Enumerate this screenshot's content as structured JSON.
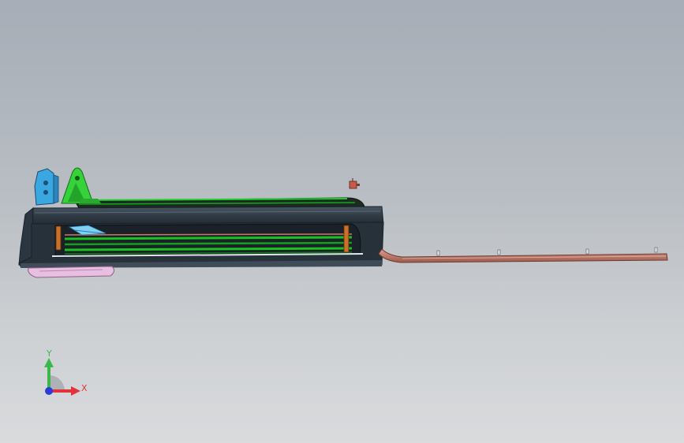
{
  "viewport": {
    "background_top": "#a6adb6",
    "background_bottom": "#d9dbdd"
  },
  "model": {
    "colors": {
      "housing": "#2f3a44",
      "housing_edge": "#18212a",
      "rail_green": "#19c21f",
      "bracket_blue": "#3aa7e0",
      "bracket_green": "#35d23a",
      "rod_red": "#c77a6a",
      "pink_part": "#e8bfe0",
      "orange_post": "#c9702b"
    }
  },
  "triad": {
    "y_label": "Y",
    "x_label": "X",
    "y_color": "#3cb84a",
    "x_color": "#e0343a",
    "origin_color": "#2a3bd8"
  }
}
